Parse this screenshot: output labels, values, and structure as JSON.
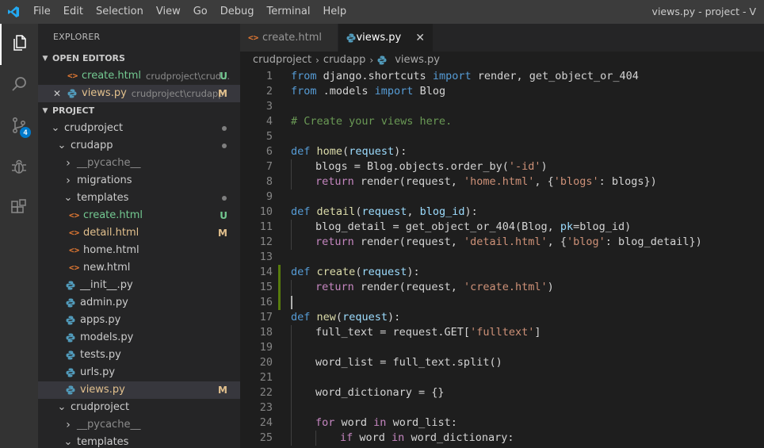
{
  "menu": [
    "File",
    "Edit",
    "Selection",
    "View",
    "Go",
    "Debug",
    "Terminal",
    "Help"
  ],
  "window_title": "views.py - project - V",
  "activity": {
    "scm_badge": "4"
  },
  "explorer": {
    "title": "EXPLORER",
    "open_editors_label": "OPEN EDITORS",
    "open_editors": [
      {
        "name": "create.html",
        "path": "crudproject\\crud...",
        "status": "U"
      },
      {
        "name": "views.py",
        "path": "crudproject\\crudapp",
        "status": "M",
        "close": "✕"
      }
    ],
    "project_label": "PROJECT",
    "tree": [
      {
        "name": "crudproject"
      },
      {
        "name": "crudapp"
      },
      {
        "name": "__pycache__"
      },
      {
        "name": "migrations"
      },
      {
        "name": "templates"
      },
      {
        "name": "create.html",
        "status": "U"
      },
      {
        "name": "detail.html",
        "status": "M"
      },
      {
        "name": "home.html"
      },
      {
        "name": "new.html"
      },
      {
        "name": "__init__.py"
      },
      {
        "name": "admin.py"
      },
      {
        "name": "apps.py"
      },
      {
        "name": "models.py"
      },
      {
        "name": "tests.py"
      },
      {
        "name": "urls.py"
      },
      {
        "name": "views.py",
        "status": "M"
      },
      {
        "name": "crudproject"
      },
      {
        "name": "__pycache__"
      },
      {
        "name": "templates"
      }
    ]
  },
  "tabs": [
    {
      "label": "create.html",
      "active": false
    },
    {
      "label": "views.py",
      "active": true,
      "close": "✕"
    }
  ],
  "breadcrumb": [
    "crudproject",
    "crudapp",
    "views.py"
  ],
  "editor": {
    "line_numbers": [
      "1",
      "2",
      "3",
      "4",
      "5",
      "6",
      "7",
      "8",
      "9",
      "10",
      "11",
      "12",
      "13",
      "14",
      "15",
      "16",
      "17",
      "18",
      "19",
      "20",
      "21",
      "22",
      "23",
      "24",
      "25"
    ],
    "lines": [
      [
        [
          "kw",
          "from"
        ],
        [
          "tx",
          " django.shortcuts "
        ],
        [
          "kw",
          "import"
        ],
        [
          "tx",
          " render, get_object_or_404"
        ]
      ],
      [
        [
          "kw",
          "from"
        ],
        [
          "tx",
          " .models "
        ],
        [
          "kw",
          "import"
        ],
        [
          "tx",
          " Blog"
        ]
      ],
      [],
      [
        [
          "cm",
          "# Create your views here."
        ]
      ],
      [],
      [
        [
          "kw",
          "def"
        ],
        [
          "tx",
          " "
        ],
        [
          "fn",
          "home"
        ],
        [
          "tx",
          "("
        ],
        [
          "par",
          "request"
        ],
        [
          "tx",
          "):"
        ]
      ],
      [
        [
          "i",
          ""
        ],
        [
          "tx",
          "blogs = Blog.objects.order_by("
        ],
        [
          "str",
          "'-id'"
        ],
        [
          "tx",
          ")"
        ]
      ],
      [
        [
          "i",
          ""
        ],
        [
          "ctl",
          "return"
        ],
        [
          "tx",
          " render(request, "
        ],
        [
          "str",
          "'home.html'"
        ],
        [
          "tx",
          ", {"
        ],
        [
          "str",
          "'blogs'"
        ],
        [
          "tx",
          ": blogs})"
        ]
      ],
      [],
      [
        [
          "kw",
          "def"
        ],
        [
          "tx",
          " "
        ],
        [
          "fn",
          "detail"
        ],
        [
          "tx",
          "("
        ],
        [
          "par",
          "request"
        ],
        [
          "tx",
          ", "
        ],
        [
          "par",
          "blog_id"
        ],
        [
          "tx",
          "):"
        ]
      ],
      [
        [
          "i",
          ""
        ],
        [
          "tx",
          "blog_detail = get_object_or_404(Blog, "
        ],
        [
          "par",
          "pk"
        ],
        [
          "tx",
          "=blog_id)"
        ]
      ],
      [
        [
          "i",
          ""
        ],
        [
          "ctl",
          "return"
        ],
        [
          "tx",
          " render(request, "
        ],
        [
          "str",
          "'detail.html'"
        ],
        [
          "tx",
          ", {"
        ],
        [
          "str",
          "'blog'"
        ],
        [
          "tx",
          ": blog_detail})"
        ]
      ],
      [],
      [
        [
          "kw",
          "def"
        ],
        [
          "tx",
          " "
        ],
        [
          "fn",
          "create"
        ],
        [
          "tx",
          "("
        ],
        [
          "par",
          "request"
        ],
        [
          "tx",
          "):"
        ]
      ],
      [
        [
          "i",
          ""
        ],
        [
          "ctl",
          "return"
        ],
        [
          "tx",
          " render(request, "
        ],
        [
          "str",
          "'create.html'"
        ],
        [
          "tx",
          ")"
        ]
      ],
      [
        [
          "cur",
          ""
        ]
      ],
      [
        [
          "kw",
          "def"
        ],
        [
          "tx",
          " "
        ],
        [
          "fn",
          "new"
        ],
        [
          "tx",
          "("
        ],
        [
          "par",
          "request"
        ],
        [
          "tx",
          "):"
        ]
      ],
      [
        [
          "i",
          ""
        ],
        [
          "tx",
          "full_text = request.GET["
        ],
        [
          "str",
          "'fulltext'"
        ],
        [
          "tx",
          "]"
        ]
      ],
      [
        [
          "i",
          ""
        ]
      ],
      [
        [
          "i",
          ""
        ],
        [
          "tx",
          "word_list = full_text.split()"
        ]
      ],
      [
        [
          "i",
          ""
        ]
      ],
      [
        [
          "i",
          ""
        ],
        [
          "tx",
          "word_dictionary = {}"
        ]
      ],
      [
        [
          "i",
          ""
        ]
      ],
      [
        [
          "i",
          ""
        ],
        [
          "ctl",
          "for"
        ],
        [
          "tx",
          " word "
        ],
        [
          "ctl",
          "in"
        ],
        [
          "tx",
          " word_list:"
        ]
      ],
      [
        [
          "i",
          ""
        ],
        [
          "i",
          ""
        ],
        [
          "ctl",
          "if"
        ],
        [
          "tx",
          " word "
        ],
        [
          "ctl",
          "in"
        ],
        [
          "tx",
          " word_dictionary:"
        ]
      ]
    ],
    "changed_lines": [
      14,
      15,
      16
    ]
  },
  "colors": {
    "accent": "#007acc",
    "untracked": "#73c991",
    "modified": "#e2c08d",
    "html_icon": "#e37933",
    "py_icon": "#519aba"
  }
}
